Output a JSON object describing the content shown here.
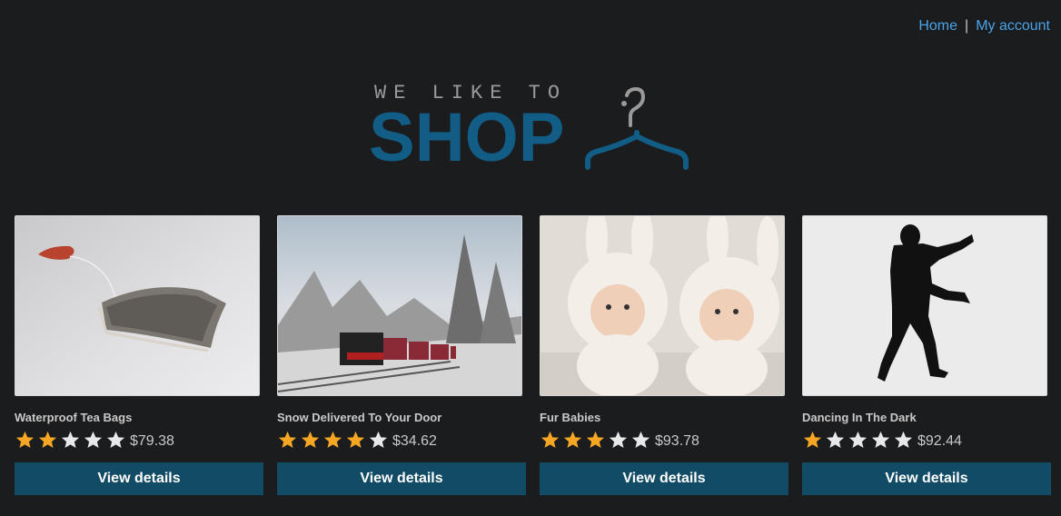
{
  "nav": {
    "home": "Home",
    "separator": "|",
    "account": "My account"
  },
  "logo": {
    "tagline": "WE LIKE TO",
    "wordmark": "SHOP",
    "hanger_color": "#125d85",
    "hook_color": "#9a9a9a"
  },
  "colors": {
    "star_filled": "#f5a623",
    "star_empty": "#e8e8e8",
    "button_bg": "#124b66",
    "link": "#4aa3e8"
  },
  "products": [
    {
      "title": "Waterproof Tea Bags",
      "rating": 2,
      "max_rating": 5,
      "price": "$79.38",
      "button": "View details"
    },
    {
      "title": "Snow Delivered To Your Door",
      "rating": 4,
      "max_rating": 5,
      "price": "$34.62",
      "button": "View details"
    },
    {
      "title": "Fur Babies",
      "rating": 3,
      "max_rating": 5,
      "price": "$93.78",
      "button": "View details"
    },
    {
      "title": "Dancing In The Dark",
      "rating": 1,
      "max_rating": 5,
      "price": "$92.44",
      "button": "View details"
    }
  ]
}
